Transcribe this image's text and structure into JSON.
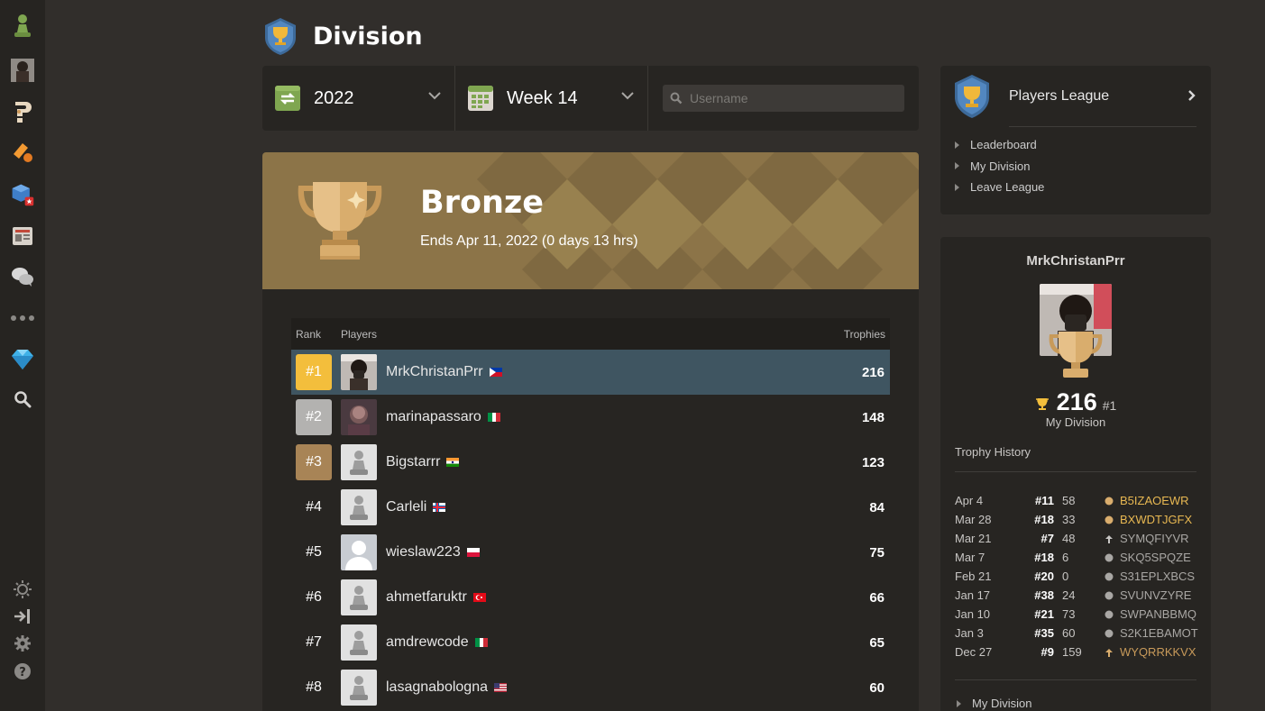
{
  "header": {
    "title": "Division"
  },
  "filters": {
    "season": "2022",
    "week": "Week 14",
    "search_placeholder": "Username"
  },
  "banner": {
    "league": "Bronze",
    "ends": "Ends Apr 11, 2022 (0 days 13 hrs)"
  },
  "table": {
    "headers": {
      "rank": "Rank",
      "players": "Players",
      "trophies": "Trophies"
    },
    "rows": [
      {
        "rank": "#1",
        "name": "MrkChristanPrr",
        "trophies": "216",
        "flag": "ph",
        "avatar": "photo-user"
      },
      {
        "rank": "#2",
        "name": "marinapassaro",
        "trophies": "148",
        "flag": "it",
        "avatar": "photo-dark"
      },
      {
        "rank": "#3",
        "name": "Bigstarrr",
        "trophies": "123",
        "flag": "in",
        "avatar": "pawn"
      },
      {
        "rank": "#4",
        "name": "Carleli",
        "trophies": "84",
        "flag": "fo",
        "avatar": "pawn"
      },
      {
        "rank": "#5",
        "name": "wieslaw223",
        "trophies": "75",
        "flag": "pl",
        "avatar": "silhouette"
      },
      {
        "rank": "#6",
        "name": "ahmetfaruktr",
        "trophies": "66",
        "flag": "tr",
        "avatar": "pawn"
      },
      {
        "rank": "#7",
        "name": "amdrewcode",
        "trophies": "65",
        "flag": "it",
        "avatar": "pawn"
      },
      {
        "rank": "#8",
        "name": "lasagnabologna",
        "trophies": "60",
        "flag": "us",
        "avatar": "pawn"
      }
    ]
  },
  "players_league": {
    "title": "Players League",
    "links": [
      "Leaderboard",
      "My Division",
      "Leave League"
    ]
  },
  "profile": {
    "username": "MrkChristanPrr",
    "trophies": "216",
    "rank": "#1",
    "division_label": "My Division",
    "history_title": "Trophy History",
    "history": [
      {
        "date": "Apr 4",
        "rank": "#11",
        "score": "58",
        "code": "B5IZAOEWR",
        "marker": "gold"
      },
      {
        "date": "Mar 28",
        "rank": "#18",
        "score": "33",
        "code": "BXWDTJGFX",
        "marker": "gold"
      },
      {
        "date": "Mar 21",
        "rank": "#7",
        "score": "48",
        "code": "SYMQFIYVR",
        "marker": "up-grey"
      },
      {
        "date": "Mar 7",
        "rank": "#18",
        "score": "6",
        "code": "SKQ5SPQZE",
        "marker": "grey"
      },
      {
        "date": "Feb 21",
        "rank": "#20",
        "score": "0",
        "code": "S31EPLXBCS",
        "marker": "grey"
      },
      {
        "date": "Jan 17",
        "rank": "#38",
        "score": "24",
        "code": "SVUNVZYRE",
        "marker": "grey"
      },
      {
        "date": "Jan 10",
        "rank": "#21",
        "score": "73",
        "code": "SWPANBBMQ",
        "marker": "grey"
      },
      {
        "date": "Jan 3",
        "rank": "#35",
        "score": "60",
        "code": "S2K1EBAMOT",
        "marker": "grey"
      },
      {
        "date": "Dec 27",
        "rank": "#9",
        "score": "159",
        "code": "WYQRRKKVX",
        "marker": "up-bronze"
      }
    ],
    "footer_link": "My Division"
  },
  "colors": {
    "bronze": "#8c7448",
    "highlight": "#3f5561",
    "gold": "#f3be3c",
    "silver": "#b3b2b0",
    "bronze_rank": "#a88456"
  }
}
